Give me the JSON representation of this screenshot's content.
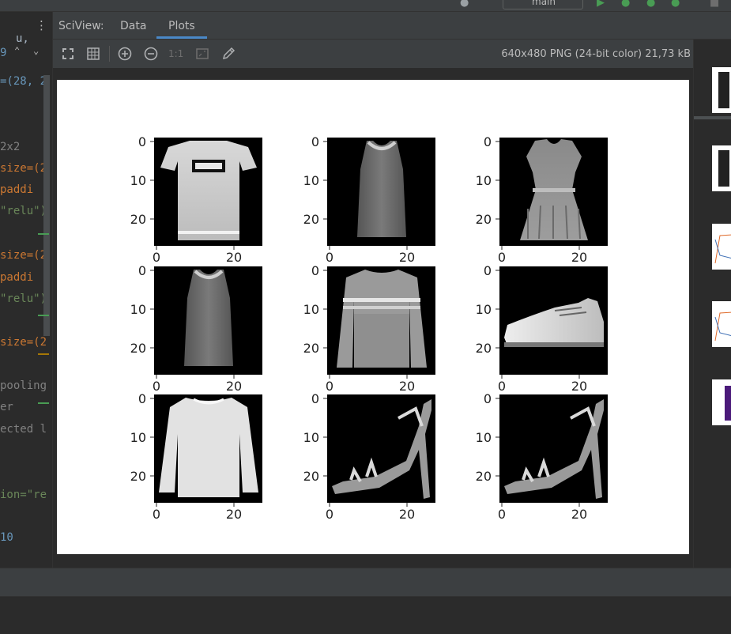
{
  "branch": {
    "label": "main"
  },
  "editor": {
    "lines": [
      {
        "text": "=(28, 2",
        "color": "#6897bb"
      },
      {
        "text": "2x2",
        "color": "#808080"
      },
      {
        "text": "size=(2",
        "color": "#cc7832"
      },
      {
        "text": "  paddi",
        "color": "#cc7832"
      },
      {
        "text": "\"relu\")",
        "color": "#6a8759"
      },
      {
        "text": "size=(2",
        "color": "#cc7832"
      },
      {
        "text": "  paddi",
        "color": "#cc7832"
      },
      {
        "text": "\"relu\")",
        "color": "#6a8759"
      },
      {
        "text": "size=(2",
        "color": "#cc7832"
      },
      {
        "text": "pooling",
        "color": "#808080"
      },
      {
        "text": "er",
        "color": "#808080"
      },
      {
        "text": "ected l",
        "color": "#808080"
      },
      {
        "text": "ion=\"re",
        "color": "#6a8759"
      },
      {
        "text": "10",
        "color": "#6897bb"
      }
    ],
    "top_fragment": "9",
    "top_fragment2": "u,"
  },
  "sciview": {
    "title": "SciView:",
    "tabs": [
      {
        "label": "Data",
        "active": false
      },
      {
        "label": "Plots",
        "active": true
      }
    ],
    "toolbar": {
      "fit_icon": "fit-screen-icon",
      "grid_icon": "grid-icon",
      "zoom_in_icon": "zoom-in-icon",
      "zoom_out_icon": "zoom-out-icon",
      "actual_size_label": "1:1",
      "fit_window_icon": "fit-window-icon",
      "color_picker_icon": "color-picker-icon"
    },
    "image_info": "640x480 PNG (24-bit color) 21,73 kB"
  },
  "plot": {
    "subplots": [
      {
        "subject": "t-shirt"
      },
      {
        "subject": "tank-top"
      },
      {
        "subject": "dress"
      },
      {
        "subject": "tank-top"
      },
      {
        "subject": "sweater"
      },
      {
        "subject": "sneaker"
      },
      {
        "subject": "pullover"
      },
      {
        "subject": "sandal"
      },
      {
        "subject": "sandal"
      }
    ],
    "ticks": {
      "y": [
        "0",
        "10",
        "20"
      ],
      "x": [
        "0",
        "20"
      ]
    }
  },
  "colors": {
    "accent": "#4a88c7",
    "background": "#2b2b2b",
    "panel": "#3c3f41"
  }
}
